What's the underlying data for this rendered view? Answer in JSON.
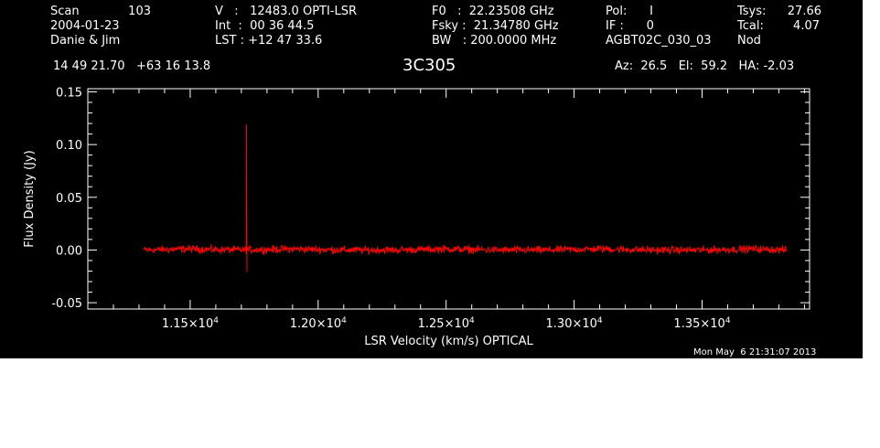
{
  "header": {
    "col1": [
      {
        "label": "Scan",
        "value": "103"
      },
      {
        "label": "2004-01-23",
        "value": ""
      },
      {
        "label": "Danie & Jim",
        "value": ""
      }
    ],
    "col2": [
      "V   :   12483.0 OPTI-LSR",
      "Int  :  00 36 44.5",
      "LST : +12 47 33.6"
    ],
    "col3": [
      "F0   :  22.23508 GHz",
      "Fsky :  21.34780 GHz",
      "BW   : 200.0000 MHz"
    ],
    "col4": [
      "Pol:      I",
      "IF :      0",
      "AGBT02C_030_03"
    ],
    "col5": [
      {
        "label": "Tsys:",
        "value": "27.66"
      },
      {
        "label": "Tcal:",
        "value": "4.07"
      },
      {
        "label": "Nod",
        "value": ""
      }
    ],
    "coords": "14 49 21.70   +63 16 13.8",
    "source": "3C305",
    "azelha": "Az:  26.5   El:  59.2   HA: -2.03"
  },
  "timestamp": "Mon May  6 21:31:07 2013",
  "colors": {
    "background": "#000000",
    "axes": "#ffffff",
    "series": "#ff0000"
  },
  "chart_data": {
    "type": "line",
    "xlabel": "LSR Velocity (km/s) OPTICAL",
    "ylabel": "Flux Density (Jy)",
    "xlim": [
      11100,
      13920
    ],
    "ylim": [
      -0.056,
      0.153
    ],
    "x_ticks": [
      {
        "value": 11500,
        "mantissa": "1.15",
        "exponent": "4"
      },
      {
        "value": 12000,
        "mantissa": "1.20",
        "exponent": "4"
      },
      {
        "value": 12500,
        "mantissa": "1.25",
        "exponent": "4"
      },
      {
        "value": 13000,
        "mantissa": "1.30",
        "exponent": "4"
      },
      {
        "value": 13500,
        "mantissa": "1.35",
        "exponent": "4"
      }
    ],
    "y_ticks": [
      {
        "value": 0.15,
        "label": "0.15"
      },
      {
        "value": 0.1,
        "label": "0.10"
      },
      {
        "value": 0.05,
        "label": "0.05"
      },
      {
        "value": 0.0,
        "label": "0.00"
      },
      {
        "value": -0.05,
        "label": "-0.05"
      }
    ],
    "series": [
      {
        "x": [
          11320,
          11500,
          11700,
          11900,
          12100,
          12300,
          12500,
          12700,
          12900,
          13100,
          13300,
          13500,
          13700,
          13830
        ],
        "y": [
          0.0,
          0.001,
          0.0,
          0.001,
          0.0,
          0.0,
          0.001,
          0.0,
          0.0,
          0.001,
          0.0,
          0.0,
          0.001,
          0.0
        ],
        "noise_rms": 0.0025,
        "spikes": [
          {
            "x": 11720,
            "peak": 0.119
          },
          {
            "x": 11722,
            "peak": -0.021
          }
        ]
      }
    ]
  }
}
